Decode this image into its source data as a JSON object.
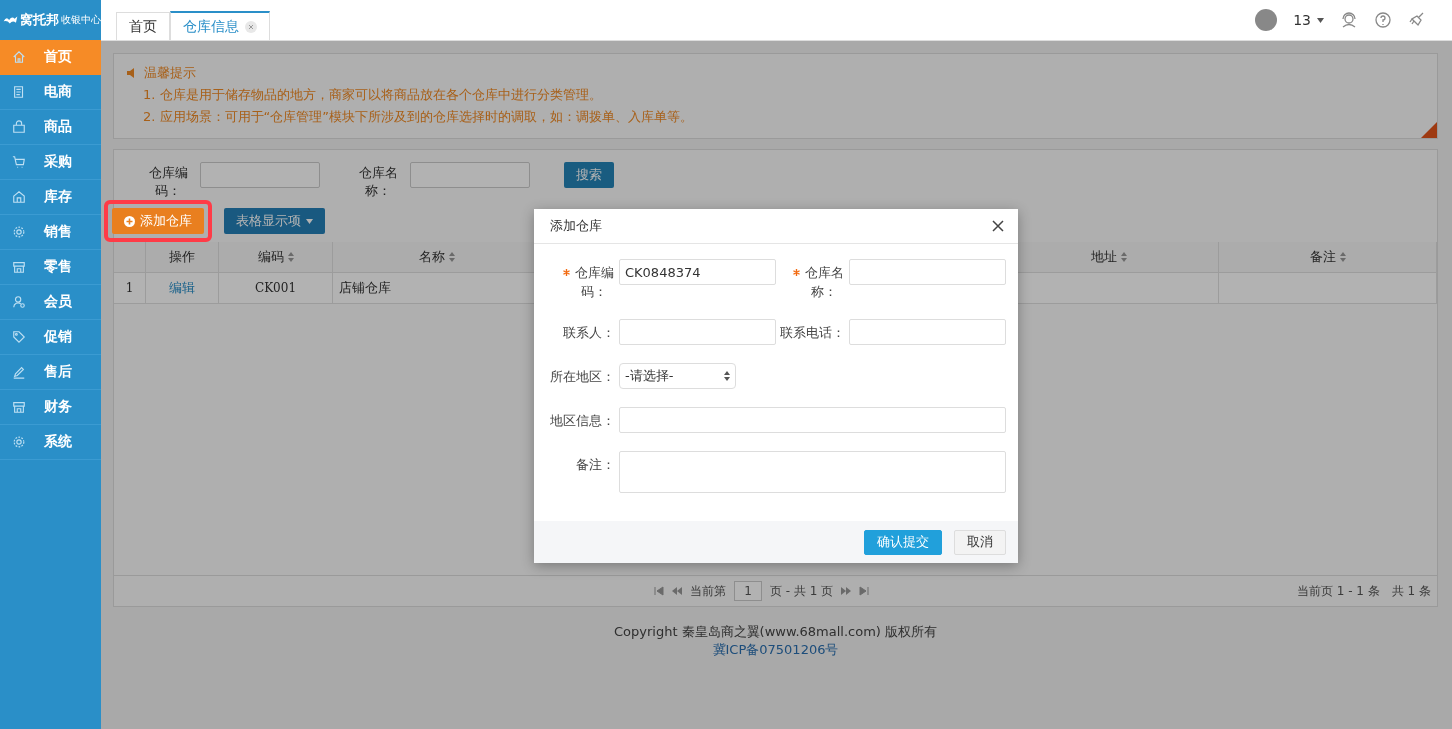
{
  "logo": {
    "name": "窝托邦",
    "subtitle": "收银中心"
  },
  "tabs": [
    {
      "label": "首页",
      "selected": false,
      "closable": false
    },
    {
      "label": "仓库信息",
      "selected": true,
      "closable": true
    }
  ],
  "user": {
    "name": "13"
  },
  "sidebar": {
    "items": [
      {
        "label": "首页",
        "kind": "home",
        "selected": true
      },
      {
        "label": "电商",
        "kind": "doc",
        "selected": false
      },
      {
        "label": "商品",
        "kind": "bag",
        "selected": false
      },
      {
        "label": "采购",
        "kind": "cart",
        "selected": false
      },
      {
        "label": "库存",
        "kind": "house",
        "selected": false
      },
      {
        "label": "销售",
        "kind": "gear",
        "selected": false
      },
      {
        "label": "零售",
        "kind": "store",
        "selected": false
      },
      {
        "label": "会员",
        "kind": "user",
        "selected": false
      },
      {
        "label": "促销",
        "kind": "tag",
        "selected": false
      },
      {
        "label": "售后",
        "kind": "pen",
        "selected": false
      },
      {
        "label": "财务",
        "kind": "store",
        "selected": false
      },
      {
        "label": "系统",
        "kind": "gear",
        "selected": false
      }
    ]
  },
  "tips": {
    "title": "温馨提示",
    "lines": [
      "1. 仓库是用于储存物品的地方，商家可以将商品放在各个仓库中进行分类管理。",
      "2. 应用场景：可用于“仓库管理”模块下所涉及到的仓库选择时的调取，如：调拨单、入库单等。"
    ]
  },
  "search": {
    "fields": [
      {
        "label": "仓库编码："
      },
      {
        "label": "仓库名称："
      }
    ],
    "button": "搜索"
  },
  "actions": {
    "add": "添加仓库",
    "highlighted": true,
    "columns_button": "表格显示项"
  },
  "table": {
    "columns": [
      {
        "label": "操作",
        "sortable": false
      },
      {
        "label": "编码",
        "sortable": true
      },
      {
        "label": "名称",
        "sortable": true
      },
      {
        "label": "地址",
        "sortable": true
      },
      {
        "label": "备注",
        "sortable": true
      }
    ],
    "rows": [
      {
        "index": "1",
        "action": "编辑",
        "code": "CK001",
        "name": "店铺仓库"
      }
    ]
  },
  "pagination": {
    "before": "当前第",
    "page": "1",
    "after": "页 - 共 1 页",
    "summary": "当前页 1 - 1 条　共 1 条"
  },
  "footer": {
    "copyright": "Copyright 秦皇岛商之翼(www.68mall.com) 版权所有",
    "icp": "冀ICP备07501206号"
  },
  "dialog": {
    "title": "添加仓库",
    "fields": [
      {
        "kind": "text",
        "label": "仓库编码：",
        "required": true,
        "value": "CK0848374"
      },
      {
        "kind": "text",
        "label": "仓库名称：",
        "required": true
      },
      {
        "kind": "text",
        "label": "联系人：",
        "required": false
      },
      {
        "kind": "text",
        "label": "联系电话：",
        "required": false
      },
      {
        "kind": "select",
        "label": "所在地区：",
        "required": false,
        "value": "-请选择-"
      },
      {
        "kind": "wide-text",
        "label": "地区信息：",
        "required": false
      },
      {
        "kind": "textarea",
        "label": "备注：",
        "required": false
      }
    ],
    "buttons": [
      {
        "label": "确认提交",
        "primary": true
      },
      {
        "label": "取消",
        "primary": false
      }
    ]
  }
}
